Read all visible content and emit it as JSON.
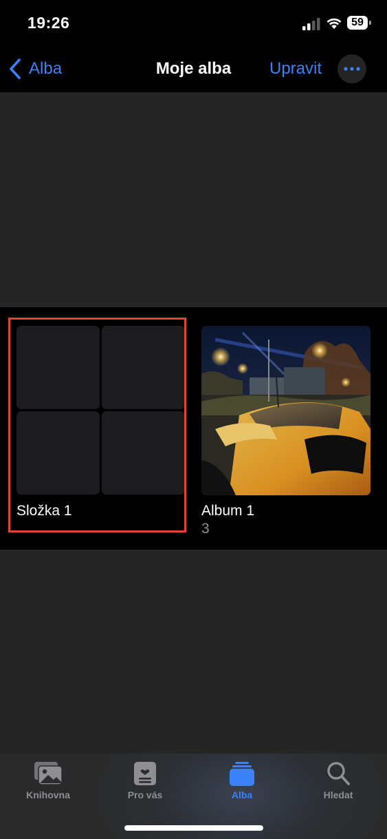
{
  "status_bar": {
    "time": "19:26",
    "battery_level": "59"
  },
  "nav": {
    "back_label": "Alba",
    "title": "Moje alba",
    "edit_label": "Upravit",
    "accent_color": "#3a82f7"
  },
  "albums": [
    {
      "name": "Složka 1",
      "count": "",
      "type": "folder",
      "highlighted": true
    },
    {
      "name": "Album 1",
      "count": "3",
      "type": "album"
    }
  ],
  "highlight_color": "#e0452c",
  "tabs": [
    {
      "label": "Knihovna",
      "icon": "photo-library-icon",
      "active": false
    },
    {
      "label": "Pro vás",
      "icon": "for-you-icon",
      "active": false
    },
    {
      "label": "Alba",
      "icon": "albums-icon",
      "active": true
    },
    {
      "label": "Hledat",
      "icon": "search-icon",
      "active": false
    }
  ]
}
